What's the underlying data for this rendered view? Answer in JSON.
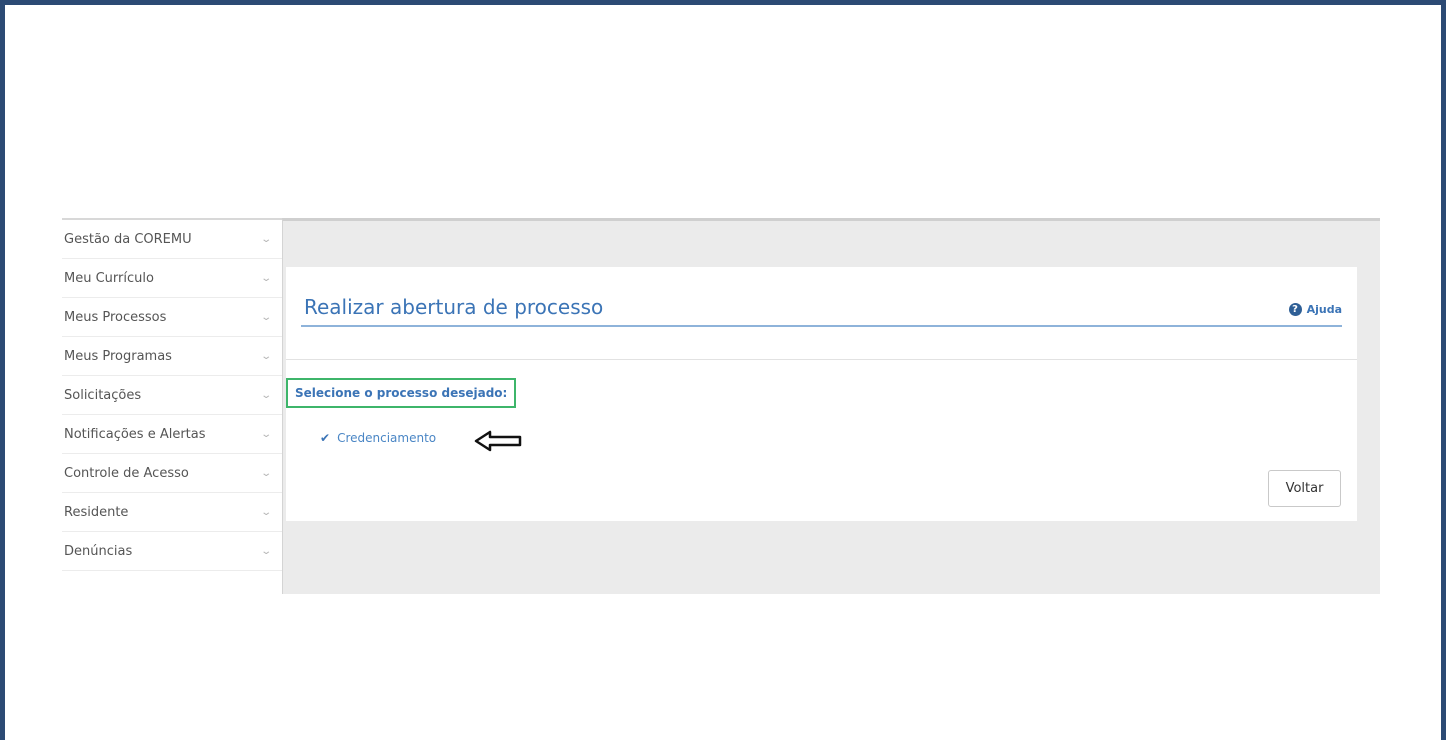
{
  "sidebar": {
    "items": [
      {
        "label": "Gestão da COREMU"
      },
      {
        "label": "Meu Currículo"
      },
      {
        "label": "Meus Processos"
      },
      {
        "label": "Meus Programas"
      },
      {
        "label": "Solicitações"
      },
      {
        "label": "Notificações e Alertas"
      },
      {
        "label": "Controle de Acesso"
      },
      {
        "label": "Residente"
      },
      {
        "label": "Denúncias"
      }
    ],
    "chevron_icon": "chevron-down-icon"
  },
  "main": {
    "title": "Realizar abertura de processo",
    "help_label": "Ajuda",
    "help_icon": "question-circle-icon",
    "select_label": "Selecione o processo desejado:",
    "options": [
      {
        "label": "Credenciamento",
        "icon": "check-icon"
      }
    ],
    "annotation_icon": "left-arrow-icon",
    "back_label": "Voltar"
  },
  "colors": {
    "frame": "#2c4a74",
    "accent": "#3b74b6",
    "highlight_box": "#3db56a",
    "content_bg": "#ebebeb"
  }
}
